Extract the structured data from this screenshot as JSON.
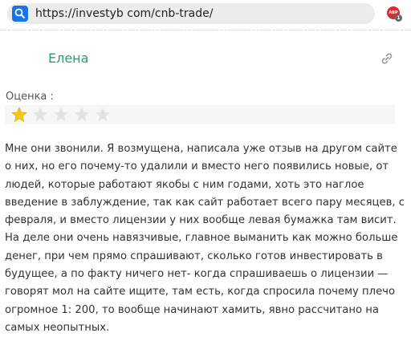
{
  "browser": {
    "url": "https://investyb com/cnb-trade/",
    "extension_badge": "ABP",
    "extension_count": "1"
  },
  "review": {
    "author": "Елена",
    "rating_label": "Оценка :",
    "rating": 1,
    "rating_max": 5,
    "star_filled_color": "#f5c518",
    "star_empty_color": "#e3e3e3",
    "body_lines": [
      "Мне они звонили. Я возмущена, написала уже отзыв на другом сайте",
      "о них, но его почему-то удалили и вместо него появились новые, от",
      "людей, которые работают якобы с ним годами, хоть это наглое",
      "введение в заблуждение, так как сайт работает всего пару месяцев, с",
      "февраля, и вместо лицензии у них вообще левая бумажка там висит.",
      "На деле они очень навязчивые, главное выманить как можно больше",
      "денег, при чем прямо спрашивают, сколько готов инвестировать в",
      "будущее, а по факту ничего нет- когда спрашиваешь о лицензии —",
      "говорят мол на сайте ищите, там есть, когда спросила почему плечо",
      "огромное 1: 200, то вообще начинают хамить, явно рассчитано на",
      "самых неопытных."
    ]
  },
  "colors": {
    "author": "#2e9a6f",
    "accent": "#1a73e8"
  }
}
